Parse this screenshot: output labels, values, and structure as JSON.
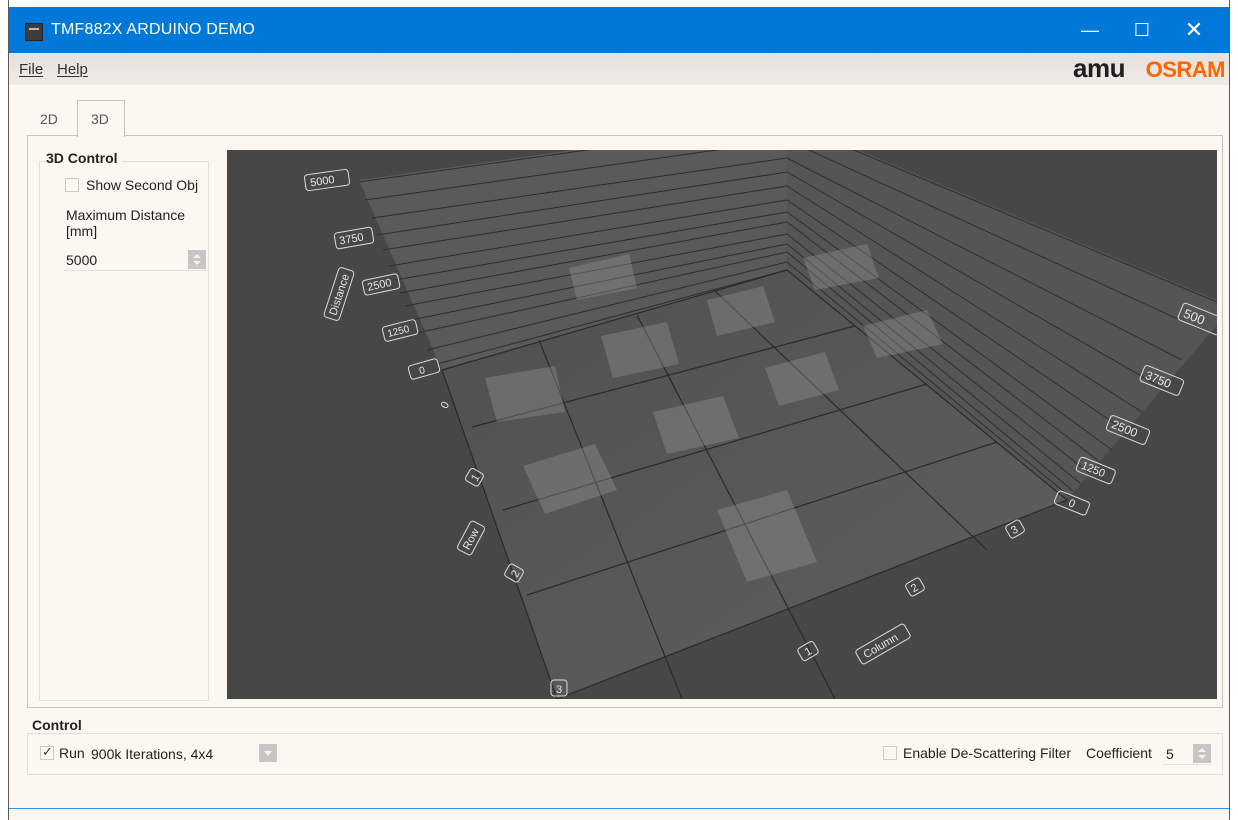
{
  "window": {
    "title": "TMF882X ARDUINO DEMO",
    "min_glyph": "—",
    "max_glyph": "☐",
    "close_glyph": "✕",
    "accent": "#0078d7"
  },
  "menu": {
    "file": "File",
    "help": "Help"
  },
  "logos": {
    "ams": "amu",
    "osram": "OSRAM",
    "osram_color": "#ff6600"
  },
  "tabs": [
    {
      "label": "2D",
      "active": false
    },
    {
      "label": "3D",
      "active": true
    }
  ],
  "control3d": {
    "group_title": "3D Control",
    "show_second_object": {
      "label": "Show Second Obj",
      "checked": false
    },
    "max_distance_label_1": "Maximum Distance",
    "max_distance_label_2": "[mm]",
    "max_distance_value": "5000"
  },
  "view3d": {
    "distance_axis_title": "Distance",
    "distance_ticks_left": [
      "5000",
      "3750",
      "2500",
      "1250",
      "0"
    ],
    "distance_ticks_right": [
      "500",
      "3750",
      "2500",
      "1250",
      "0"
    ],
    "row_axis_title": "Row",
    "row_ticks": [
      "0",
      "1",
      "2",
      "3"
    ],
    "column_axis_title": "Column",
    "column_ticks": [
      "1",
      "2",
      "3"
    ],
    "floor_color": "#5c5c5c",
    "background_color": "#474747"
  },
  "control": {
    "group_title": "Control",
    "run": {
      "label": "Run",
      "checked": true
    },
    "mode_value": "900k Iterations, 4x4",
    "descatter": {
      "label": "Enable De-Scattering Filter",
      "checked": false
    },
    "coefficient_label": "Coefficient",
    "coefficient_value": "5"
  }
}
